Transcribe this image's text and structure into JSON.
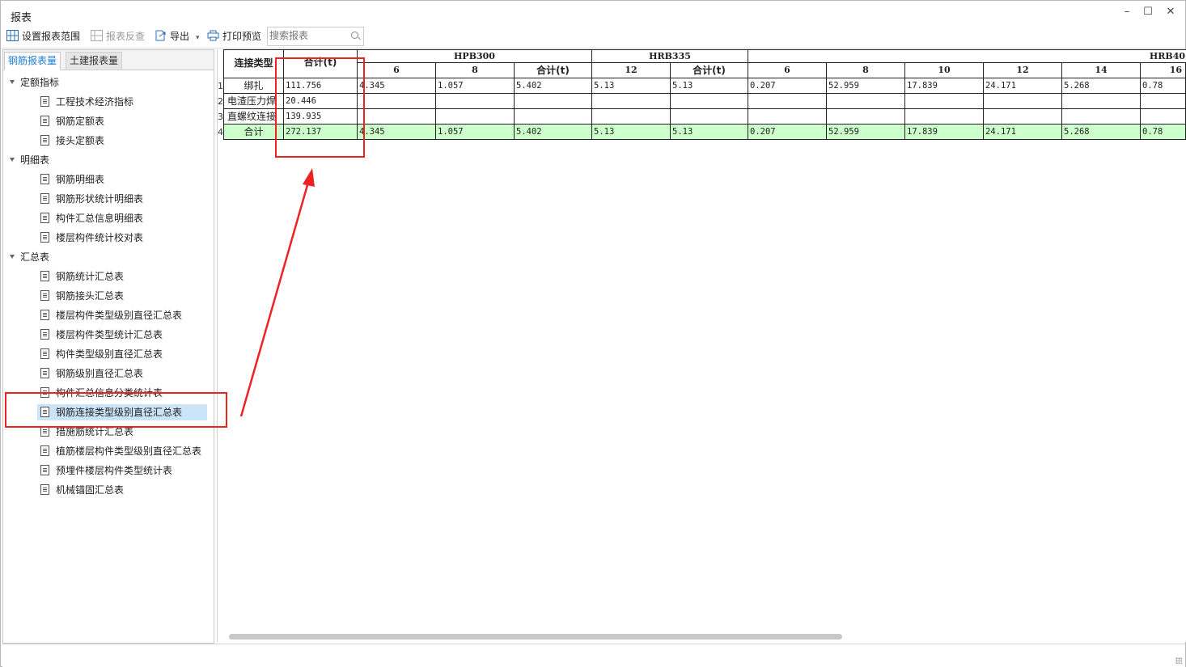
{
  "window": {
    "title": "报表",
    "min_icon": "minimize-icon",
    "max_icon": "maximize-icon",
    "close_icon": "close-icon"
  },
  "toolbar": {
    "set_range": "设置报表范围",
    "report_reverse": "报表反查",
    "export": "导出",
    "print_preview": "打印预览",
    "search_placeholder": "搜索报表"
  },
  "tabs": {
    "rebar": "钢筋报表量",
    "civil": "土建报表量"
  },
  "tree": {
    "groups": [
      {
        "label": "定额指标",
        "items": [
          "工程技术经济指标",
          "钢筋定额表",
          "接头定额表"
        ]
      },
      {
        "label": "明细表",
        "items": [
          "钢筋明细表",
          "钢筋形状统计明细表",
          "构件汇总信息明细表",
          "楼层构件统计校对表"
        ]
      },
      {
        "label": "汇总表",
        "items": [
          "钢筋统计汇总表",
          "钢筋接头汇总表",
          "楼层构件类型级别直径汇总表",
          "楼层构件类型统计汇总表",
          "构件类型级别直径汇总表",
          "钢筋级别直径汇总表",
          "构件汇总信息分类统计表",
          "钢筋连接类型级别直径汇总表",
          "措施筋统计汇总表",
          "植筋楼层构件类型级别直径汇总表",
          "预埋件楼层构件类型统计表",
          "机械锚固汇总表"
        ]
      }
    ],
    "selected": "钢筋连接类型级别直径汇总表"
  },
  "table": {
    "corner_header": "连接类型",
    "total_header": "合计(t)",
    "group_headers": [
      "HPB300",
      "HRB335",
      "HRB40"
    ],
    "sub_headers": [
      "6",
      "8",
      "合计(t)",
      "12",
      "合计(t)",
      "6",
      "8",
      "10",
      "12",
      "14",
      "16"
    ],
    "row_numbers": [
      "1",
      "2",
      "3",
      "4"
    ],
    "rows": [
      {
        "label": "绑扎",
        "total": "111.756",
        "values": [
          "4.345",
          "1.057",
          "5.402",
          "5.13",
          "5.13",
          "0.207",
          "52.959",
          "17.839",
          "24.171",
          "5.268",
          "0.78"
        ]
      },
      {
        "label": "电渣压力焊",
        "total": "20.446",
        "values": [
          "",
          "",
          "",
          "",
          "",
          "",
          "",
          "",
          "",
          "",
          ""
        ]
      },
      {
        "label": "直螺纹连接",
        "total": "139.935",
        "values": [
          "",
          "",
          "",
          "",
          "",
          "",
          "",
          "",
          "",
          "",
          ""
        ]
      },
      {
        "label": "合计",
        "total": "272.137",
        "values": [
          "4.345",
          "1.057",
          "5.402",
          "5.13",
          "5.13",
          "0.207",
          "52.959",
          "17.839",
          "24.171",
          "5.268",
          "0.78"
        ]
      }
    ]
  },
  "colors": {
    "annotation": "#ee2222",
    "total_row": "#ccffcc",
    "selection": "#cce4f7",
    "active_tab": "#1e7bd6"
  }
}
